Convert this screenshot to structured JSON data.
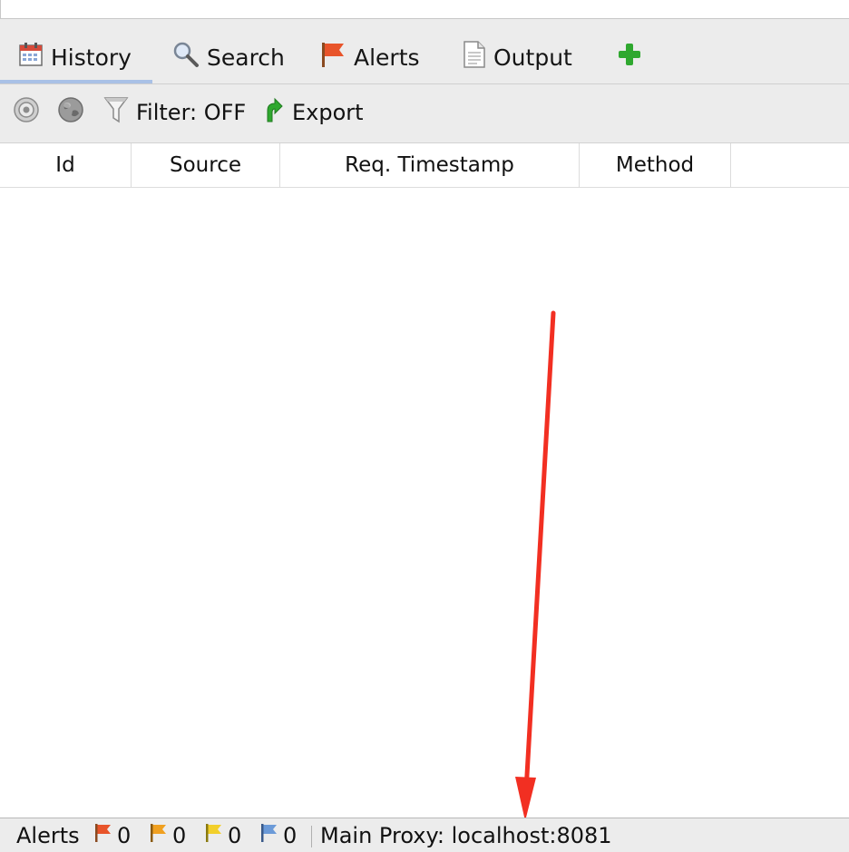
{
  "tabs": [
    {
      "label": "History",
      "icon": "calendar-icon",
      "active": true
    },
    {
      "label": "Search",
      "icon": "magnifier-icon"
    },
    {
      "label": "Alerts",
      "icon": "flag-icon"
    },
    {
      "label": "Output",
      "icon": "document-icon"
    },
    {
      "label": "",
      "icon": "plus-icon"
    }
  ],
  "toolbar": {
    "filter_label": "Filter: OFF",
    "export_label": "Export"
  },
  "table": {
    "columns": [
      "Id",
      "Source",
      "Req. Timestamp",
      "Method"
    ]
  },
  "statusbar": {
    "alerts_label": "Alerts",
    "counts": {
      "high": "0",
      "medium": "0",
      "low": "0",
      "info": "0"
    },
    "proxy_label": "Main Proxy: localhost:8081"
  },
  "colors": {
    "annotation_arrow": "#f22f22",
    "add_icon": "#2fa82f",
    "export_icon": "#2fa82f",
    "flag_high": "#e8542a",
    "flag_medium": "#f0a020",
    "flag_low": "#f2cf2a",
    "flag_info": "#6b9ad8"
  }
}
